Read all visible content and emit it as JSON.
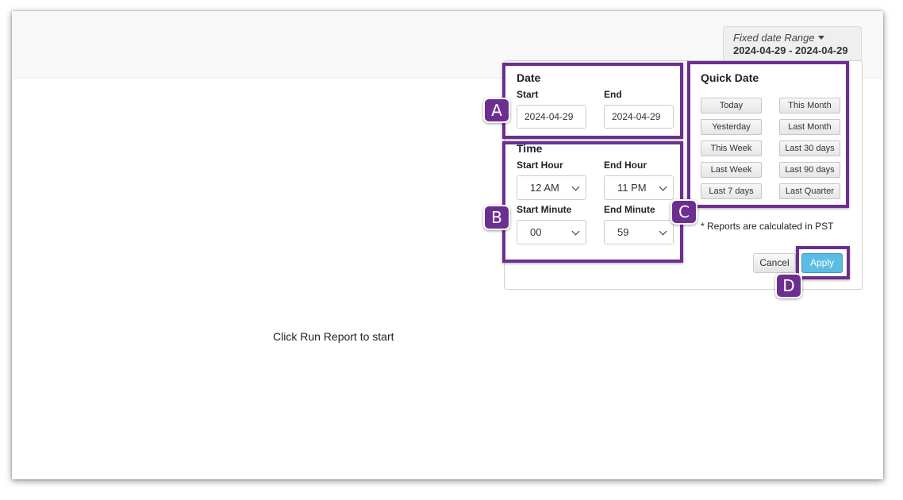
{
  "header": {
    "range_label": "Fixed date Range",
    "range_value": "2024-04-29 - 2024-04-29"
  },
  "main": {
    "empty_message": "Click Run Report to start"
  },
  "date_section": {
    "title": "Date",
    "start_label": "Start",
    "start_value": "2024-04-29",
    "end_label": "End",
    "end_value": "2024-04-29"
  },
  "time_section": {
    "title": "Time",
    "start_hour_label": "Start Hour",
    "start_hour_value": "12 AM",
    "end_hour_label": "End Hour",
    "end_hour_value": "11 PM",
    "start_minute_label": "Start Minute",
    "start_minute_value": "00",
    "end_minute_label": "End Minute",
    "end_minute_value": "59"
  },
  "quick_date": {
    "title": "Quick Date",
    "buttons": [
      "Today",
      "This Month",
      "Yesterday",
      "Last Month",
      "This Week",
      "Last 30 days",
      "Last Week",
      "Last 90 days",
      "Last 7 days",
      "Last Quarter"
    ]
  },
  "footer": {
    "note": "* Reports are calculated in PST",
    "cancel_label": "Cancel",
    "apply_label": "Apply"
  },
  "annotations": {
    "a": "A",
    "b": "B",
    "c": "C",
    "d": "D",
    "highlight_color": "#6c2f8f"
  },
  "colors": {
    "apply_button": "#5bbde4"
  }
}
